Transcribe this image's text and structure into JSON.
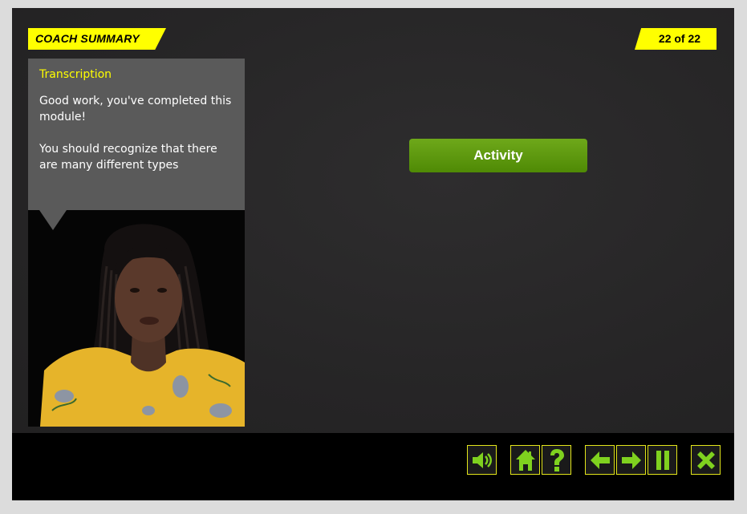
{
  "header": {
    "section_tag": "COACH SUMMARY",
    "page_counter": "22 of 22"
  },
  "transcript": {
    "title": "Transcription",
    "paragraphs": [
      "Good work, you've completed this module!",
      "You should recognize that there are many different types"
    ]
  },
  "main": {
    "activity_button": "Activity"
  },
  "toolbar": {
    "buttons": [
      {
        "icon": "speaker-icon"
      },
      {
        "icon": "home-icon"
      },
      {
        "icon": "help-icon"
      },
      {
        "icon": "arrow-left-icon"
      },
      {
        "icon": "arrow-right-icon"
      },
      {
        "icon": "pause-icon"
      },
      {
        "icon": "close-icon"
      }
    ]
  },
  "colors": {
    "accent_yellow": "#ffff00",
    "button_green": "#5a9a0d",
    "icon_green": "#7fd11f",
    "stage_bg": "#262526"
  }
}
